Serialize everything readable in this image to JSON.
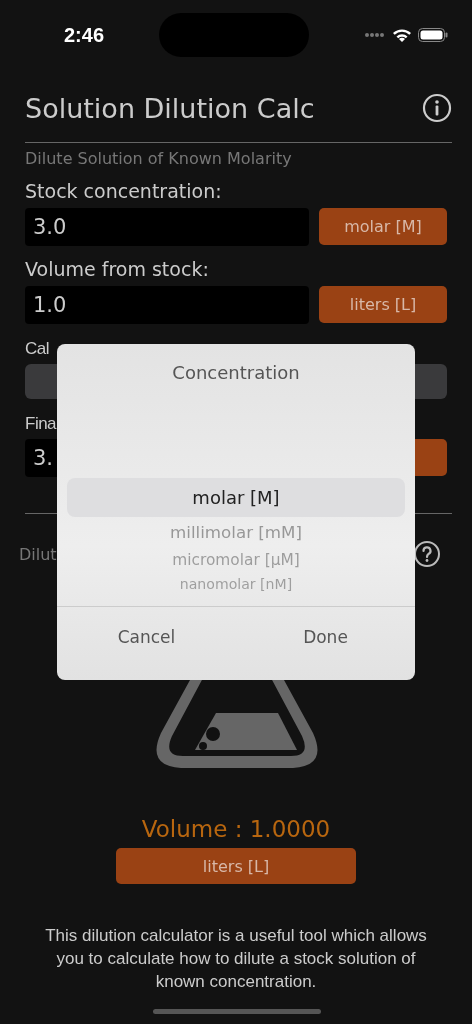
{
  "status_bar": {
    "time": "2:46"
  },
  "header": {
    "title": "Solution Dilution Calc"
  },
  "section": {
    "subtitle": "Dilute Solution of Known Molarity"
  },
  "rows": [
    {
      "label": "Stock concentration:",
      "value": "3.0",
      "unit": "molar [M]"
    },
    {
      "label": "Volume from stock:",
      "value": "1.0",
      "unit": "liters [L]"
    }
  ],
  "hidden_rows": [
    {
      "label": "Cal",
      "kind": "bar"
    },
    {
      "label": "Fina",
      "kind": "field",
      "value": "3."
    }
  ],
  "result_section": {
    "label": "Dilut",
    "volume": "Volume : 1.0000",
    "unit": "liters [L]",
    "description": "This dilution calculator is a useful tool which allows you to calculate how to dilute a stock solution of known concentration."
  },
  "picker_dialog": {
    "title": "Concentration",
    "options": [
      {
        "label": "molar [M]",
        "selected": true
      },
      {
        "label": "millimolar [mM]",
        "selected": false
      },
      {
        "label": "micromolar [μM]",
        "selected": false
      },
      {
        "label": "nanomolar [nM]",
        "selected": false
      }
    ],
    "buttons": [
      "Cancel",
      "Done"
    ]
  }
}
